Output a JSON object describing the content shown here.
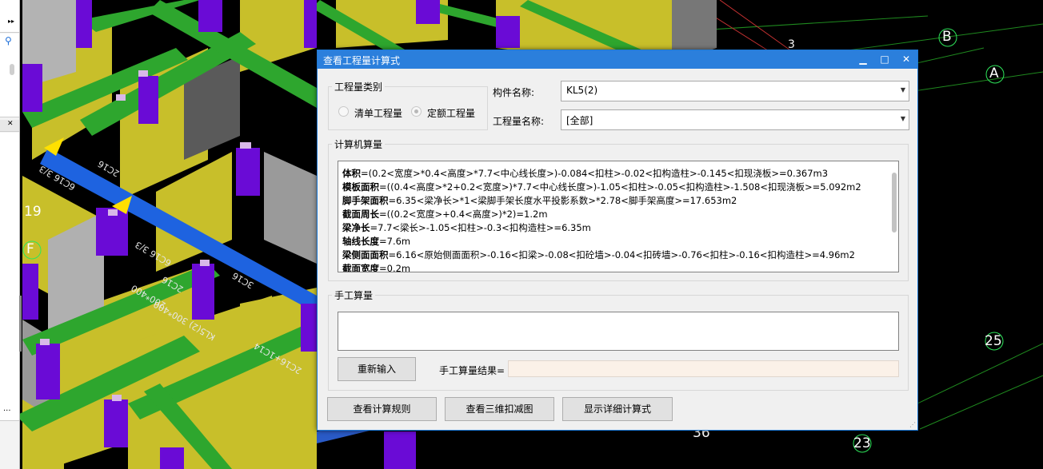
{
  "background": {
    "axis_labels": {
      "B": "B",
      "A": "A",
      "F": "F",
      "n19": "19",
      "n25": "25",
      "n23": "23",
      "n36": "36",
      "n3": "3"
    },
    "rebar_labels": {
      "l1": "6C16 3/3",
      "l2": "2C16",
      "l3": "6C16 3/3",
      "l4": "3C16",
      "l5": "2C16",
      "l6": "200*400",
      "l7": "KL5(2) 300*400",
      "l8": "2C16+1C14"
    },
    "colors": {
      "wall": "#c8bf2a",
      "beam_green": "#2ea62e",
      "beam_blue": "#1e63e0",
      "column_purple": "#6a0bd6"
    }
  },
  "dialog": {
    "title": "查看工程量计算式",
    "controls": {
      "minimize": "▁",
      "maximize": "□",
      "close": "✕"
    },
    "type_group": {
      "title": "工程量类别",
      "option1": "清单工程量",
      "option2": "定额工程量"
    },
    "component_label": "构件名称:",
    "component_value": "KL5(2)",
    "quantity_label": "工程量名称:",
    "quantity_value": "[全部]",
    "computer_group_title": "计算机算量",
    "formulas": [
      {
        "name": "体积",
        "expr": "=(0.2<宽度>*0.4<高度>*7.7<中心线长度>)-0.084<扣柱>-0.02<扣构造柱>-0.145<扣现浇板>=0.367m3"
      },
      {
        "name": "模板面积",
        "expr": "=((0.4<高度>*2+0.2<宽度>)*7.7<中心线长度>)-1.05<扣柱>-0.05<扣构造柱>-1.508<扣现浇板>=5.092m2"
      },
      {
        "name": "脚手架面积",
        "expr": "=6.35<梁净长>*1<梁脚手架长度水平投影系数>*2.78<脚手架高度>=17.653m2"
      },
      {
        "name": "截面周长",
        "expr": "=((0.2<宽度>+0.4<高度>)*2)=1.2m"
      },
      {
        "name": "梁净长",
        "expr": "=7.7<梁长>-1.05<扣柱>-0.3<扣构造柱>=6.35m"
      },
      {
        "name": "轴线长度",
        "expr": "=7.6m"
      },
      {
        "name": "梁侧面面积",
        "expr": "=6.16<原始侧面面积>-0.16<扣梁>-0.08<扣砼墙>-0.04<扣砖墙>-0.76<扣柱>-0.16<扣构造柱>=4.96m2"
      },
      {
        "name": "截面宽度",
        "expr": "=0.2m"
      }
    ],
    "manual_group_title": "手工算量",
    "reenter_button": "重新输入",
    "manual_result_label": "手工算量结果=",
    "manual_result_value": "",
    "btn_rules": "查看计算规则",
    "btn_3d": "查看三维扣减图",
    "btn_detail": "显示详细计算式"
  },
  "left_panel": {
    "arrow": "▸▸",
    "search_icon": "search-icon",
    "dots": "..."
  }
}
